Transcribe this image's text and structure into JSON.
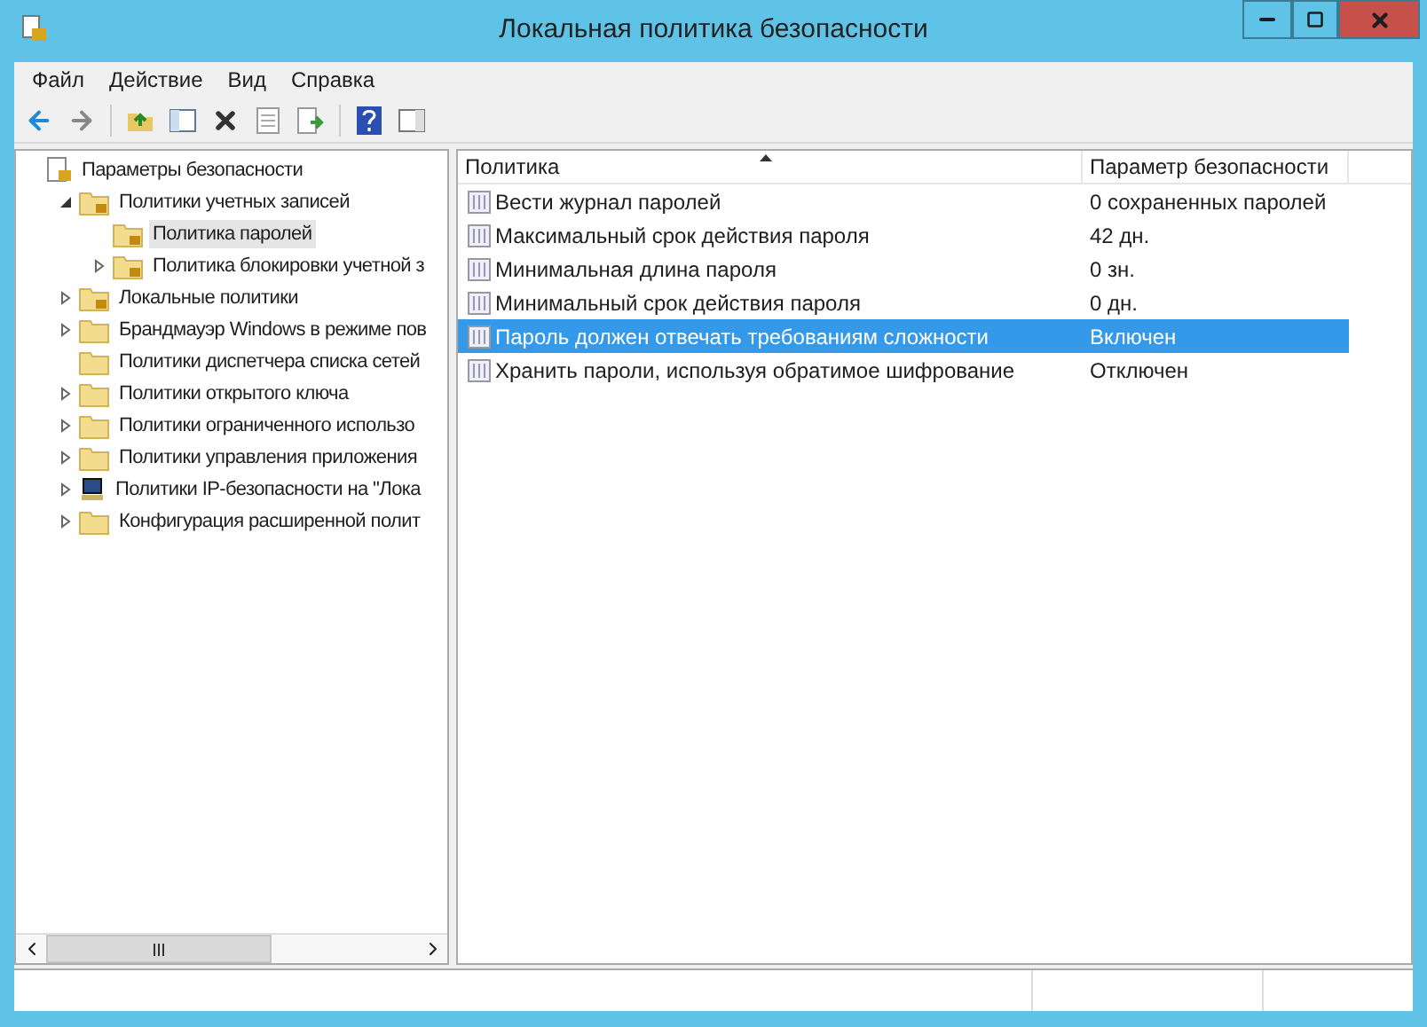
{
  "window": {
    "title": "Локальная политика безопасности"
  },
  "menu": [
    "Файл",
    "Действие",
    "Вид",
    "Справка"
  ],
  "tree": [
    {
      "label": "Параметры безопасности",
      "kind": "root",
      "selected": false,
      "children": [
        {
          "label": "Политики учетных записей",
          "kind": "locked-folder",
          "expanded": true,
          "selected": false,
          "children": [
            {
              "label": "Политика паролей",
              "kind": "locked-folder",
              "selected": true
            },
            {
              "label": "Политика блокировки учетной з",
              "kind": "locked-folder",
              "expanded": false,
              "selected": false
            }
          ]
        },
        {
          "label": "Локальные политики",
          "kind": "locked-folder",
          "expanded": false,
          "selected": false
        },
        {
          "label": "Брандмауэр Windows в режиме пов",
          "kind": "folder",
          "expanded": false,
          "selected": false
        },
        {
          "label": "Политики диспетчера списка сетей",
          "kind": "folder",
          "selected": false
        },
        {
          "label": "Политики открытого ключа",
          "kind": "folder",
          "expanded": false,
          "selected": false
        },
        {
          "label": "Политики ограниченного использо",
          "kind": "folder",
          "expanded": false,
          "selected": false
        },
        {
          "label": "Политики управления приложения",
          "kind": "folder",
          "expanded": false,
          "selected": false
        },
        {
          "label": "Политики IP-безопасности на \"Лока",
          "kind": "network",
          "expanded": false,
          "selected": false
        },
        {
          "label": "Конфигурация расширенной полит",
          "kind": "folder",
          "expanded": false,
          "selected": false
        }
      ]
    }
  ],
  "table": {
    "columns": [
      "Политика",
      "Параметр безопасности"
    ],
    "rows": [
      {
        "policy": "Вести журнал паролей",
        "value": "0 сохраненных паролей",
        "selected": false
      },
      {
        "policy": "Максимальный срок действия пароля",
        "value": "42 дн.",
        "selected": false
      },
      {
        "policy": "Минимальная длина пароля",
        "value": "0 зн.",
        "selected": false
      },
      {
        "policy": "Минимальный срок действия пароля",
        "value": "0 дн.",
        "selected": false
      },
      {
        "policy": "Пароль должен отвечать требованиям сложности",
        "value": "Включен",
        "selected": true
      },
      {
        "policy": "Хранить пароли, используя обратимое шифрование",
        "value": "Отключен",
        "selected": false
      }
    ]
  }
}
